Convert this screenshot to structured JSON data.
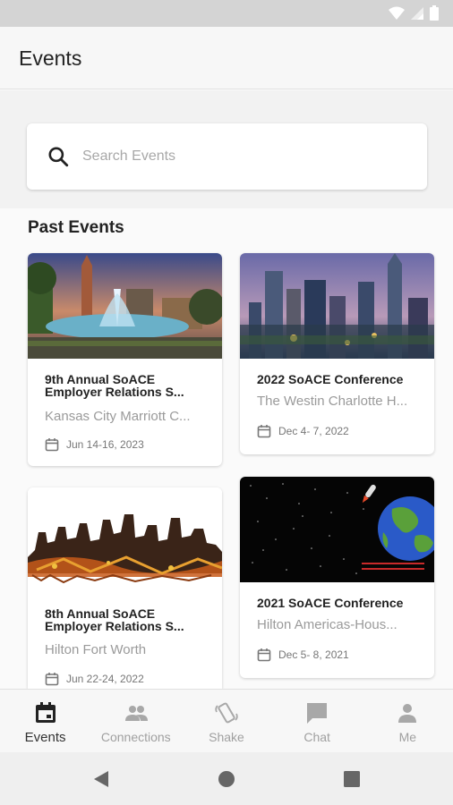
{
  "app": {
    "title": "Events"
  },
  "search": {
    "placeholder": "Search Events"
  },
  "section": {
    "title": "Past Events"
  },
  "events": [
    {
      "title": "9th Annual SoACE Employer Relations S...",
      "venue": "Kansas City Marriott C...",
      "date": "Jun 14-16, 2023"
    },
    {
      "title": "2022 SoACE Conference",
      "venue": "The Westin Charlotte H...",
      "date": "Dec  4- 7, 2022"
    },
    {
      "title": "8th Annual SoACE Employer Relations S...",
      "venue": "Hilton Fort Worth",
      "date": "Jun 22-24, 2022"
    },
    {
      "title": "2021 SoACE Conference",
      "venue": "Hilton Americas-Hous...",
      "date": "Dec  5- 8, 2021"
    }
  ],
  "bottom_nav": [
    {
      "label": "Events",
      "icon": "calendar-icon",
      "active": true
    },
    {
      "label": "Connections",
      "icon": "people-icon",
      "active": false
    },
    {
      "label": "Shake",
      "icon": "shake-icon",
      "active": false
    },
    {
      "label": "Chat",
      "icon": "chat-icon",
      "active": false
    },
    {
      "label": "Me",
      "icon": "person-icon",
      "active": false
    }
  ],
  "colors": {
    "accent": "#222222",
    "inactive": "#a0a0a0",
    "background": "#fafafa"
  }
}
